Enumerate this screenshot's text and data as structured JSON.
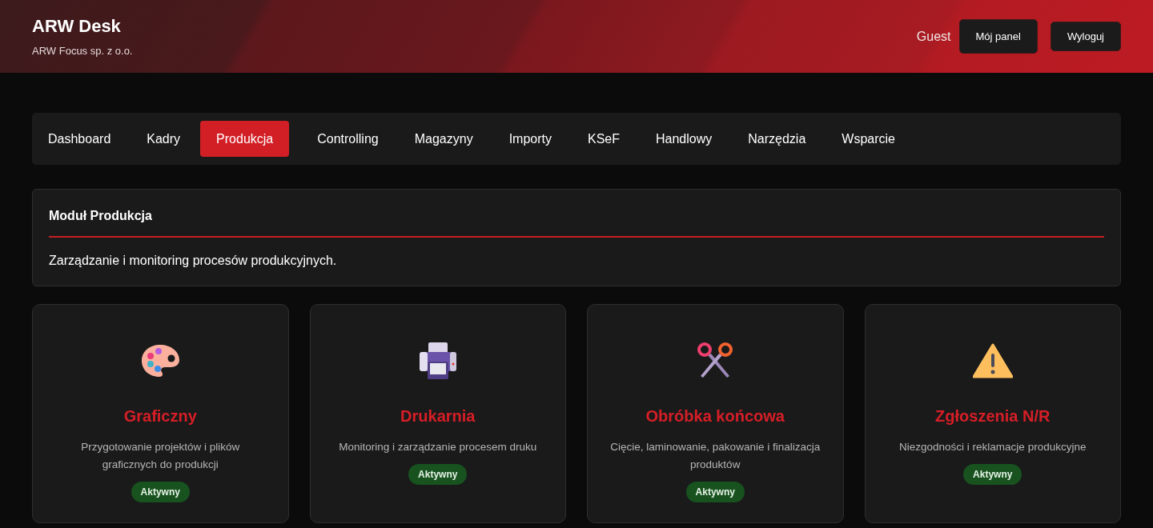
{
  "header": {
    "title": "ARW Desk",
    "subtitle": "ARW Focus sp. z o.o.",
    "user": "Guest",
    "buttons": [
      "Mój panel",
      "Wyloguj"
    ]
  },
  "tabs": [
    {
      "label": "Dashboard",
      "selected": false
    },
    {
      "label": "Kadry",
      "selected": false
    },
    {
      "label": "Produkcja",
      "selected": true
    },
    {
      "label": "Controlling",
      "selected": false
    },
    {
      "label": "Magazyny",
      "selected": false
    },
    {
      "label": "Importy",
      "selected": false
    },
    {
      "label": "KSeF",
      "selected": false
    },
    {
      "label": "Handlowy",
      "selected": false
    },
    {
      "label": "Narzędzia",
      "selected": false
    },
    {
      "label": "Wsparcie",
      "selected": false
    }
  ],
  "module": {
    "title": "Moduł Produkcja",
    "description": "Zarządzanie i monitoring procesów produkcyjnych."
  },
  "cards": [
    {
      "title": "Graficzny",
      "description": "Przygotowanie projektów i plików graficznych do produkcji",
      "status": "Aktywny"
    },
    {
      "title": "Drukarnia",
      "description": "Monitoring i zarządzanie procesem druku",
      "status": "Aktywny"
    },
    {
      "title": "Obróbka końcowa",
      "description": "Cięcie, laminowanie, pakowanie i finalizacja produktów",
      "status": "Aktywny"
    },
    {
      "title": "Zgłoszenia N/R",
      "description": "Niezgodności i reklamacje produkcyjne",
      "status": "Aktywny"
    }
  ]
}
